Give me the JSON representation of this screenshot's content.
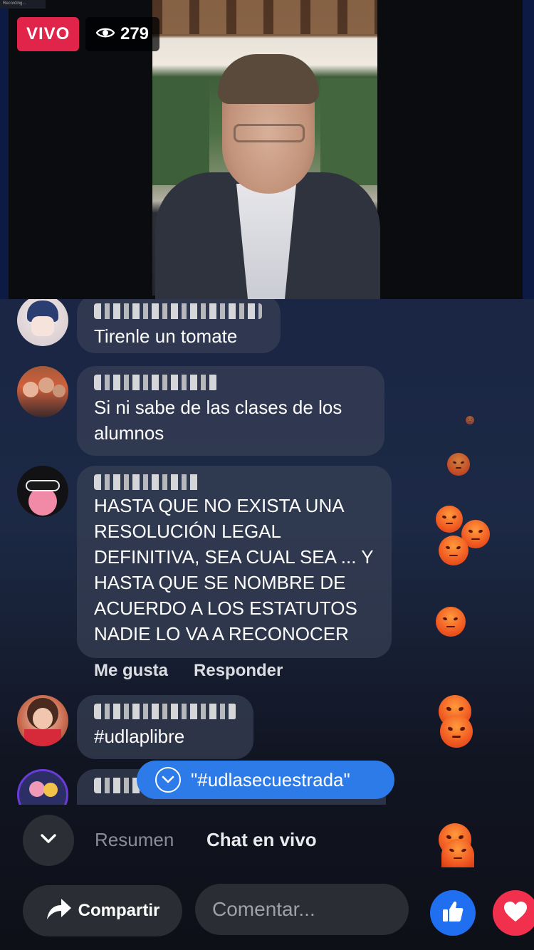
{
  "live": {
    "badge_label": "VIVO",
    "viewer_count": "279",
    "recording_label": "Recording..."
  },
  "comments": [
    {
      "text": "Tirenle un tomate"
    },
    {
      "text": "Si ni sabe de las clases de los alumnos"
    },
    {
      "text": "HASTA QUE NO EXISTA UNA RESOLUCIÓN LEGAL DEFINITIVA, SEA CUAL SEA ... Y HASTA QUE SE NOMBRE DE ACUERDO A LOS ESTATUTOS NADIE LO VA A RECONOCER"
    },
    {
      "text": "#udlaplibre"
    },
    {
      "text": ""
    }
  ],
  "comment_actions": {
    "like_label": "Me gusta",
    "reply_label": "Responder"
  },
  "hashtag_pill": {
    "label": "\"#udlasecuestrada\""
  },
  "tabs": {
    "summary_label": "Resumen",
    "live_chat_label": "Chat en vivo"
  },
  "bottom_bar": {
    "share_label": "Compartir",
    "comment_placeholder": "Comentar..."
  },
  "colors": {
    "live_red": "#e0244a",
    "accent_blue": "#2d7be9",
    "like_blue": "#1f6ff0",
    "love_red": "#f0304d"
  },
  "icons": [
    "eye-icon",
    "chevron-down-icon",
    "share-arrow-icon",
    "thumbs-up-icon",
    "heart-icon",
    "angry-reaction-icon"
  ]
}
